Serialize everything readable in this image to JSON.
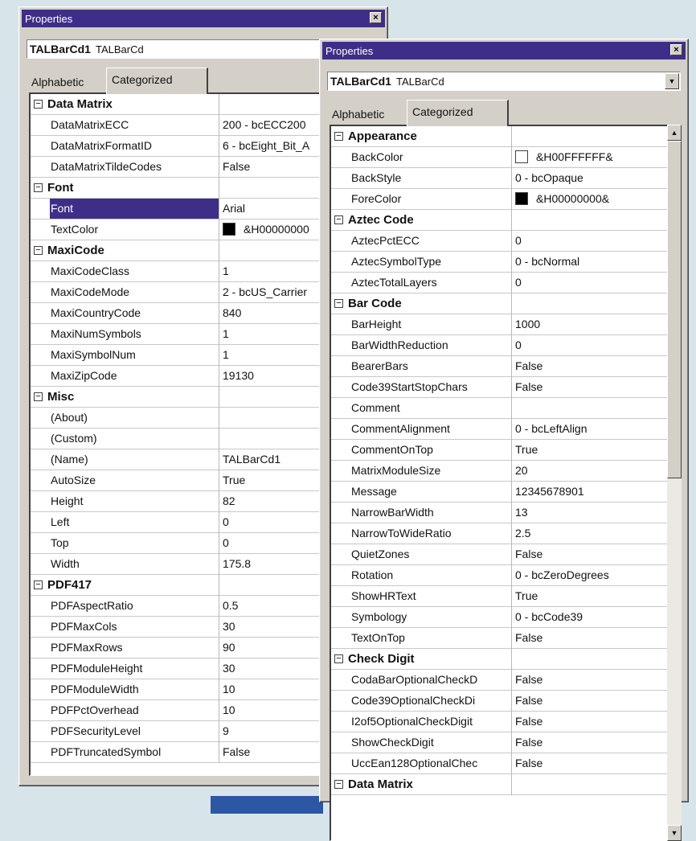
{
  "window_left": {
    "title": "Properties",
    "close_glyph": "×",
    "object": {
      "name": "TALBarCd1",
      "type": "TALBarCd"
    },
    "tabs": [
      "Alphabetic",
      "Categorized"
    ],
    "active_tab": 1,
    "rows": [
      {
        "cat": true,
        "name": "Data Matrix"
      },
      {
        "name": "DataMatrixECC",
        "value": "200 - bcECC200"
      },
      {
        "name": "DataMatrixFormatID",
        "value": "6 - bcEight_Bit_A"
      },
      {
        "name": "DataMatrixTildeCodes",
        "value": "False"
      },
      {
        "cat": true,
        "name": "Font"
      },
      {
        "name": "Font",
        "value": "Arial",
        "selected": true
      },
      {
        "name": "TextColor",
        "value": "&H00000000",
        "swatch": "#000000"
      },
      {
        "cat": true,
        "name": "MaxiCode"
      },
      {
        "name": "MaxiCodeClass",
        "value": "1"
      },
      {
        "name": "MaxiCodeMode",
        "value": "2 - bcUS_Carrier"
      },
      {
        "name": "MaxiCountryCode",
        "value": "840"
      },
      {
        "name": "MaxiNumSymbols",
        "value": "1"
      },
      {
        "name": "MaxiSymbolNum",
        "value": "1"
      },
      {
        "name": "MaxiZipCode",
        "value": "19130"
      },
      {
        "cat": true,
        "name": "Misc"
      },
      {
        "name": "(About)",
        "value": ""
      },
      {
        "name": "(Custom)",
        "value": ""
      },
      {
        "name": "(Name)",
        "value": "TALBarCd1"
      },
      {
        "name": "AutoSize",
        "value": "True"
      },
      {
        "name": "Height",
        "value": "82"
      },
      {
        "name": "Left",
        "value": "0"
      },
      {
        "name": "Top",
        "value": "0"
      },
      {
        "name": "Width",
        "value": "175.8"
      },
      {
        "cat": true,
        "name": "PDF417"
      },
      {
        "name": "PDFAspectRatio",
        "value": "0.5"
      },
      {
        "name": "PDFMaxCols",
        "value": "30"
      },
      {
        "name": "PDFMaxRows",
        "value": "90"
      },
      {
        "name": "PDFModuleHeight",
        "value": "30"
      },
      {
        "name": "PDFModuleWidth",
        "value": "10"
      },
      {
        "name": "PDFPctOverhead",
        "value": "10"
      },
      {
        "name": "PDFSecurityLevel",
        "value": "9"
      },
      {
        "name": "PDFTruncatedSymbol",
        "value": "False"
      }
    ]
  },
  "window_right": {
    "title": "Properties",
    "close_glyph": "×",
    "combo_glyph": "▼",
    "scroll_up_glyph": "▲",
    "scroll_down_glyph": "▼",
    "scroll_position": 0.0,
    "object": {
      "name": "TALBarCd1",
      "type": "TALBarCd"
    },
    "tabs": [
      "Alphabetic",
      "Categorized"
    ],
    "active_tab": 1,
    "rows": [
      {
        "cat": true,
        "name": "Appearance"
      },
      {
        "name": "BackColor",
        "value": "&H00FFFFFF&",
        "swatch": "#ffffff"
      },
      {
        "name": "BackStyle",
        "value": "0 - bcOpaque"
      },
      {
        "name": "ForeColor",
        "value": "&H00000000&",
        "swatch": "#000000"
      },
      {
        "cat": true,
        "name": "Aztec Code"
      },
      {
        "name": "AztecPctECC",
        "value": "0"
      },
      {
        "name": "AztecSymbolType",
        "value": "0 - bcNormal"
      },
      {
        "name": "AztecTotalLayers",
        "value": "0"
      },
      {
        "cat": true,
        "name": "Bar Code"
      },
      {
        "name": "BarHeight",
        "value": "1000"
      },
      {
        "name": "BarWidthReduction",
        "value": "0"
      },
      {
        "name": "BearerBars",
        "value": "False"
      },
      {
        "name": "Code39StartStopChars",
        "value": "False"
      },
      {
        "name": "Comment",
        "value": ""
      },
      {
        "name": "CommentAlignment",
        "value": "0 - bcLeftAlign"
      },
      {
        "name": "CommentOnTop",
        "value": "True"
      },
      {
        "name": "MatrixModuleSize",
        "value": "20"
      },
      {
        "name": "Message",
        "value": "12345678901"
      },
      {
        "name": "NarrowBarWidth",
        "value": "13"
      },
      {
        "name": "NarrowToWideRatio",
        "value": "2.5"
      },
      {
        "name": "QuietZones",
        "value": "False"
      },
      {
        "name": "Rotation",
        "value": "0 - bcZeroDegrees"
      },
      {
        "name": "ShowHRText",
        "value": "True"
      },
      {
        "name": "Symbology",
        "value": "0 - bcCode39"
      },
      {
        "name": "TextOnTop",
        "value": "False"
      },
      {
        "cat": true,
        "name": "Check Digit"
      },
      {
        "name": "CodaBarOptionalCheckD",
        "value": "False"
      },
      {
        "name": "Code39OptionalCheckDi",
        "value": "False"
      },
      {
        "name": "I2of5OptionalCheckDigit",
        "value": "False"
      },
      {
        "name": "ShowCheckDigit",
        "value": "False"
      },
      {
        "name": "UccEan128OptionalChec",
        "value": "False"
      },
      {
        "cat": true,
        "name": "Data Matrix"
      }
    ]
  }
}
